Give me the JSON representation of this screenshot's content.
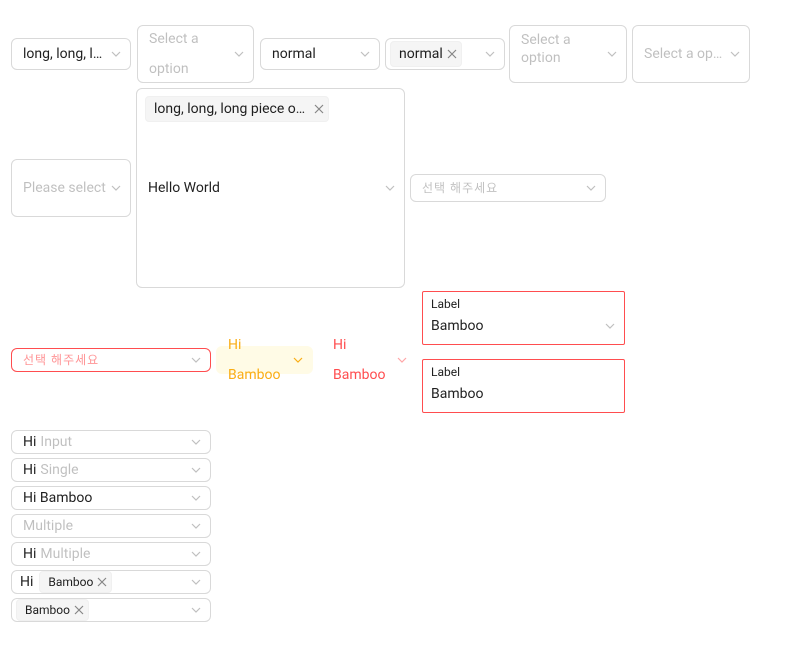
{
  "row1": {
    "s1": {
      "value": "long, long, lon…"
    },
    "s2": {
      "placeholder": "Select a option"
    },
    "s3": {
      "value": "normal"
    },
    "s4": {
      "tag": "normal"
    },
    "s5": {
      "placeholder": "Select a option"
    },
    "s6": {
      "placeholder": "Select a option"
    }
  },
  "row2": {
    "left": {
      "placeholder": "Please select"
    },
    "mid": {
      "tag": "long, long, long piece of text",
      "placeholder": "Hello World"
    },
    "right": {
      "placeholder": "선택 해주세요"
    }
  },
  "row3": {
    "err": {
      "placeholder": "선택 해주세요"
    },
    "warn1": {
      "value": "Hi Bamboo"
    },
    "warn2": {
      "value": "Hi Bamboo"
    }
  },
  "labels": {
    "a": {
      "label": "Label",
      "value": "Bamboo"
    },
    "b": {
      "label": "Label",
      "value": "Bamboo"
    }
  },
  "stack": {
    "s1": {
      "prefix": "Hi",
      "placeholder": "Input"
    },
    "s2": {
      "prefix": "Hi",
      "placeholder": "Single"
    },
    "s3": {
      "value": "Hi Bamboo"
    },
    "s4": {
      "placeholder": "Multiple"
    },
    "s5": {
      "prefix": "Hi",
      "placeholder": "Multiple"
    },
    "s6": {
      "prefix": "Hi",
      "tag": "Bamboo"
    },
    "s7": {
      "tag": "Bamboo"
    }
  }
}
